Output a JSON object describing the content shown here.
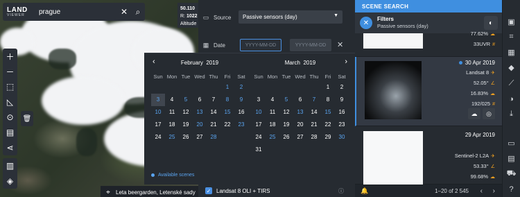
{
  "app": {
    "logo_line1": "LAND",
    "logo_line2": "VIEWER"
  },
  "search": {
    "value": "prague"
  },
  "coords": {
    "line1": "50.110",
    "r_label": "R:",
    "r_value": "1022",
    "altitude": "Altitude"
  },
  "source": {
    "label": "Source",
    "value": "Passive sensors (day)"
  },
  "date": {
    "label": "Date",
    "from_placeholder": "YYYY-MM-DD",
    "to_placeholder": "YYYY-MM-DD"
  },
  "calendar": {
    "weekdays": [
      "Sun",
      "Mon",
      "Tue",
      "Wed",
      "Thu",
      "Fri",
      "Sat"
    ],
    "left": {
      "month": "February",
      "year": "2019",
      "days": [
        [
          "",
          "",
          ""
        ],
        [
          "",
          "",
          ""
        ],
        [
          "",
          "",
          ""
        ],
        [
          "",
          "",
          ""
        ],
        [
          "",
          "",
          ""
        ],
        [
          "1",
          "b",
          ""
        ],
        [
          "2",
          "b",
          ""
        ],
        [
          "3",
          "b",
          "sel"
        ],
        [
          "4",
          "",
          ""
        ],
        [
          "5",
          "b",
          ""
        ],
        [
          "6",
          "",
          ""
        ],
        [
          "7",
          "",
          ""
        ],
        [
          "8",
          "b",
          ""
        ],
        [
          "9",
          "b",
          ""
        ],
        [
          "10",
          "b",
          ""
        ],
        [
          "11",
          "",
          ""
        ],
        [
          "12",
          "",
          ""
        ],
        [
          "13",
          "b",
          ""
        ],
        [
          "14",
          "",
          ""
        ],
        [
          "15",
          "b",
          ""
        ],
        [
          "16",
          "",
          ""
        ],
        [
          "17",
          "",
          ""
        ],
        [
          "18",
          "",
          ""
        ],
        [
          "19",
          "",
          ""
        ],
        [
          "20",
          "b",
          ""
        ],
        [
          "21",
          "",
          ""
        ],
        [
          "22",
          "",
          ""
        ],
        [
          "23",
          "b",
          ""
        ],
        [
          "24",
          "",
          ""
        ],
        [
          "25",
          "b",
          ""
        ],
        [
          "26",
          "",
          ""
        ],
        [
          "27",
          "",
          ""
        ],
        [
          "28",
          "b",
          ""
        ]
      ]
    },
    "right": {
      "month": "March",
      "year": "2019",
      "days": [
        [
          "",
          "",
          ""
        ],
        [
          "",
          "",
          ""
        ],
        [
          "",
          "",
          ""
        ],
        [
          "",
          "",
          ""
        ],
        [
          "",
          "",
          ""
        ],
        [
          "1",
          "",
          ""
        ],
        [
          "2",
          "",
          ""
        ],
        [
          "3",
          "",
          ""
        ],
        [
          "4",
          "",
          ""
        ],
        [
          "5",
          "b",
          ""
        ],
        [
          "6",
          "",
          ""
        ],
        [
          "7",
          "b",
          ""
        ],
        [
          "8",
          "",
          ""
        ],
        [
          "9",
          "",
          ""
        ],
        [
          "10",
          "b",
          ""
        ],
        [
          "11",
          "",
          ""
        ],
        [
          "12",
          "",
          ""
        ],
        [
          "13",
          "b",
          ""
        ],
        [
          "14",
          "",
          ""
        ],
        [
          "15",
          "b",
          ""
        ],
        [
          "16",
          "",
          ""
        ],
        [
          "17",
          "",
          ""
        ],
        [
          "18",
          "",
          ""
        ],
        [
          "19",
          "",
          ""
        ],
        [
          "20",
          "",
          ""
        ],
        [
          "21",
          "",
          ""
        ],
        [
          "22",
          "",
          ""
        ],
        [
          "23",
          "",
          ""
        ],
        [
          "24",
          "",
          ""
        ],
        [
          "25",
          "b",
          ""
        ],
        [
          "26",
          "",
          ""
        ],
        [
          "27",
          "",
          ""
        ],
        [
          "28",
          "",
          ""
        ],
        [
          "29",
          "",
          ""
        ],
        [
          "30",
          "b",
          ""
        ],
        [
          "31",
          "",
          ""
        ]
      ]
    },
    "legend": "Available scenes"
  },
  "satellite": {
    "label": "Landsat 8 OLI + TIRS"
  },
  "place": {
    "label": "Leta beergarden, Letenské sady"
  },
  "scene": {
    "header": "SCENE SEARCH",
    "filters_title": "Filters",
    "filters_sub": "Passive sensors (day)",
    "card0": {
      "line1": "77.62%",
      "line2": "33UVR"
    },
    "card1": {
      "date": "30 Apr 2019",
      "sensor": "Landsat 8",
      "angle": "52.05°",
      "cloud": "16.83%",
      "tile": "192/025"
    },
    "card2": {
      "date": "29 Apr 2019",
      "sensor": "Sentinel-2 L2A",
      "angle": "53.33°",
      "cloud": "99.68%"
    },
    "pager": "1–20 of 2 545"
  }
}
